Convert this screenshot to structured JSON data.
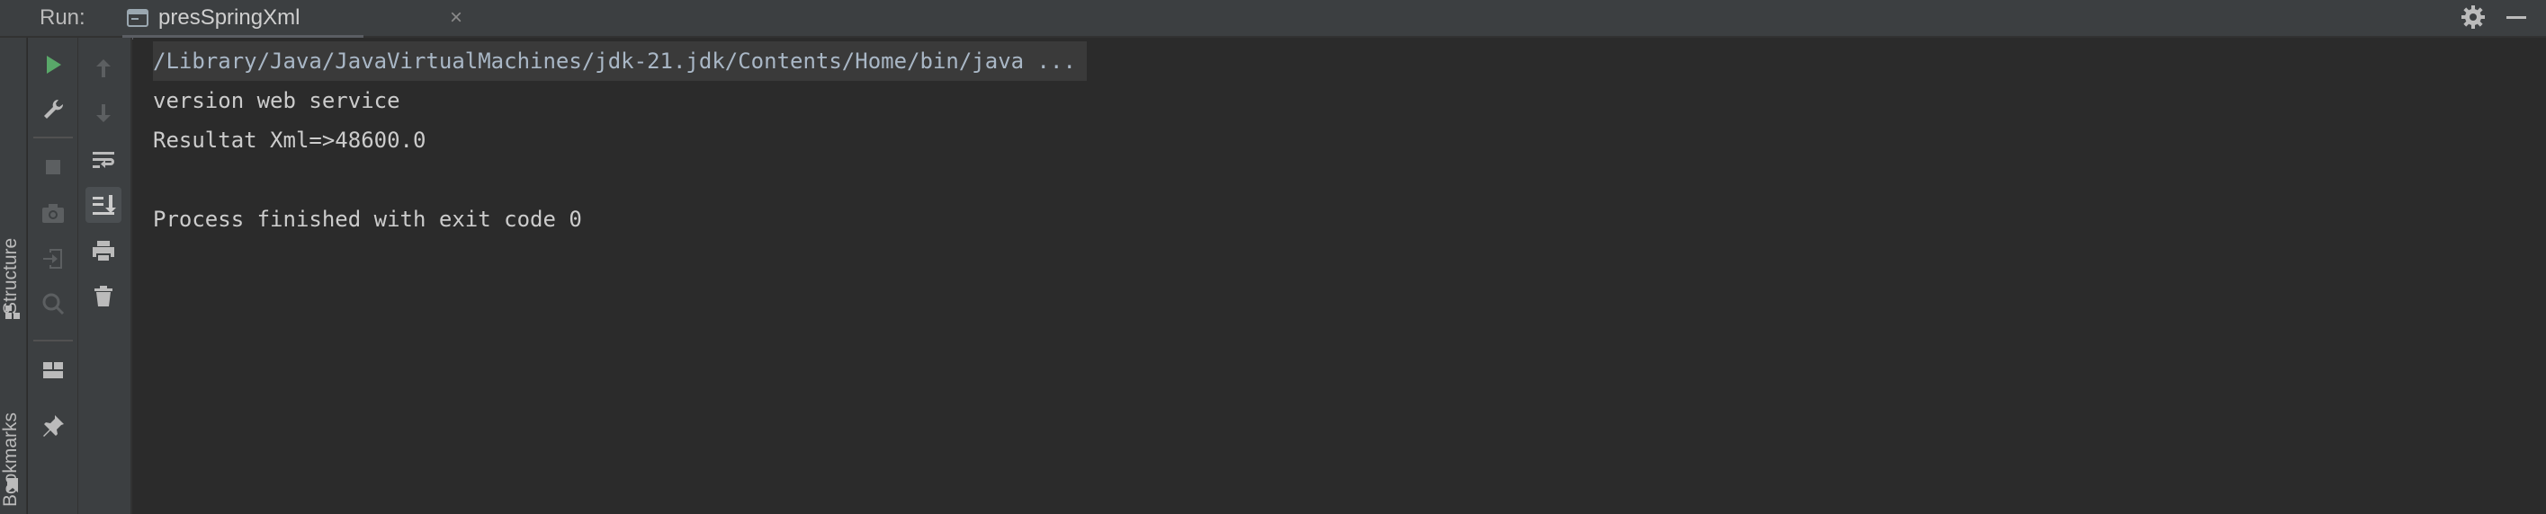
{
  "header": {
    "run_label": "Run:",
    "tab": {
      "title": "presSpringXml",
      "close": "×"
    },
    "icons": [
      "console-tab-icon",
      "gear-icon",
      "minimize-icon"
    ]
  },
  "left_strip": {
    "structure_label": "Structure",
    "bookmarks_label": "Bookmarks"
  },
  "toolbar1": {
    "items": [
      "run-icon",
      "wrench-icon",
      "stop-icon",
      "camera-icon",
      "exit-icon",
      "inspect-icon",
      "layout-icon",
      "pin-icon"
    ]
  },
  "toolbar2": {
    "items": [
      "up-arrow-icon",
      "down-arrow-icon",
      "soft-wrap-icon",
      "scroll-to-end-icon",
      "print-icon",
      "trash-icon"
    ]
  },
  "console": {
    "lines": [
      "/Library/Java/JavaVirtualMachines/jdk-21.jdk/Contents/Home/bin/java ...",
      "version web service",
      "Resultat Xml=>48600.0",
      "",
      "Process finished with exit code 0"
    ]
  },
  "colors": {
    "panel_bg": "#3c3f41",
    "console_bg": "#2b2b2b",
    "run_green": "#59a869",
    "text": "#cccccc"
  }
}
